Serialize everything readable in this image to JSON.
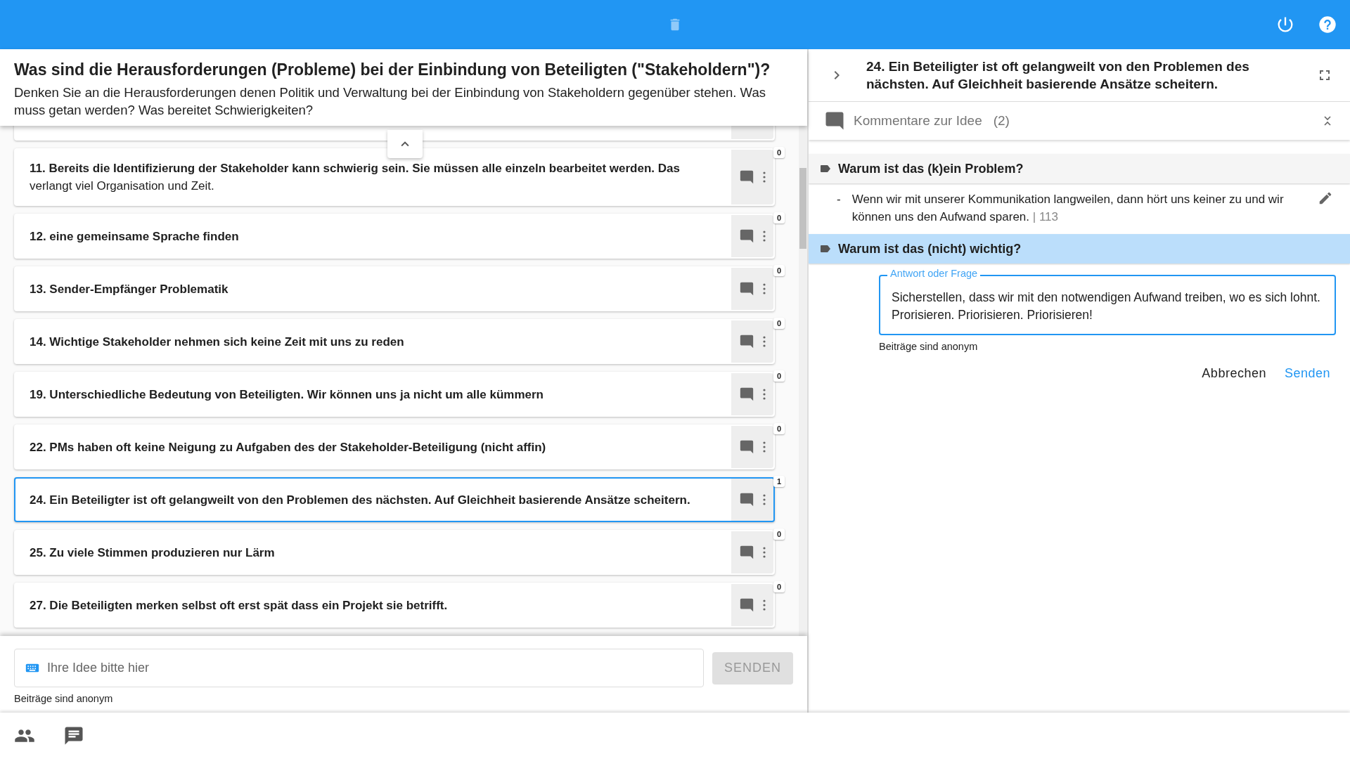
{
  "question": {
    "title": "Was sind die Herausforderungen (Probleme) bei der Einbindung von Beteiligten (\"Stakeholdern\")?",
    "description": "Denken Sie an die Herausforderungen denen Politik und Verwaltung bei der Einbindung von Stakeholdern gegenüber stehen. Was muss getan werden? Was bereitet Schwierigkeiten?"
  },
  "ideas": [
    {
      "title": "11. Bereits die Identifizierung der Stakeholder kann schwierig sein. Sie müssen alle einzeln bearbeitet werden. Das",
      "description": "verlangt viel Organisation und Zeit.",
      "count": "0",
      "selected": false
    },
    {
      "title": "12. eine gemeinsame Sprache finden",
      "count": "0",
      "selected": false
    },
    {
      "title": "13. Sender-Empfänger Problematik",
      "count": "0",
      "selected": false
    },
    {
      "title": "14. Wichtige Stakeholder nehmen sich keine Zeit mit uns zu reden",
      "count": "0",
      "selected": false
    },
    {
      "title": "19. Unterschiedliche Bedeutung von Beteiligten. Wir können uns ja nicht um alle kümmern",
      "count": "0",
      "selected": false
    },
    {
      "title": "22. PMs haben oft keine Neigung zu Aufgaben des der Stakeholder-Beteiligung (nicht affin)",
      "count": "0",
      "selected": false
    },
    {
      "title": "24. Ein Beteiligter ist oft gelangweilt von den Problemen des nächsten. Auf Gleichheit basierende Ansätze scheitern.",
      "count": "1",
      "selected": true
    },
    {
      "title": "25. Zu viele Stimmen produzieren nur Lärm",
      "count": "0",
      "selected": false
    },
    {
      "title": "27. Die Beteiligten merken selbst oft erst spät dass ein Projekt sie betrifft.",
      "count": "0",
      "selected": false
    }
  ],
  "idea_input": {
    "placeholder": "Ihre Idee bitte hier",
    "button": "SENDEN",
    "disabled": true,
    "note": "Beiträge sind anonym"
  },
  "detail": {
    "title": "24. Ein Beteiligter ist oft gelangweilt von den Problemen des nächsten. Auf Gleichheit basierende Ansätze scheitern.",
    "comments_label": "Kommentare zur Idee",
    "comments_count": "(2)",
    "sections": [
      {
        "question": "Warum ist das (k)ein Problem?",
        "selected": false,
        "comments": [
          {
            "marker": "-",
            "text": "Wenn wir mit unserer Kommunikation langweilen, dann hört uns keiner zu und wir können uns den Aufwand sparen.",
            "count": "| 113"
          }
        ]
      },
      {
        "question": "Warum ist das (nicht) wichtig?",
        "selected": true
      }
    ],
    "reply": {
      "label": "Antwort oder Frage",
      "value": "Sicherstellen, dass wir mit den notwendigen Aufwand treiben, wo es sich lohnt. Prorisieren. Priorisieren. Priorisieren!",
      "note": "Beiträge sind anonym",
      "cancel": "Abbrechen",
      "send": "Senden"
    }
  }
}
